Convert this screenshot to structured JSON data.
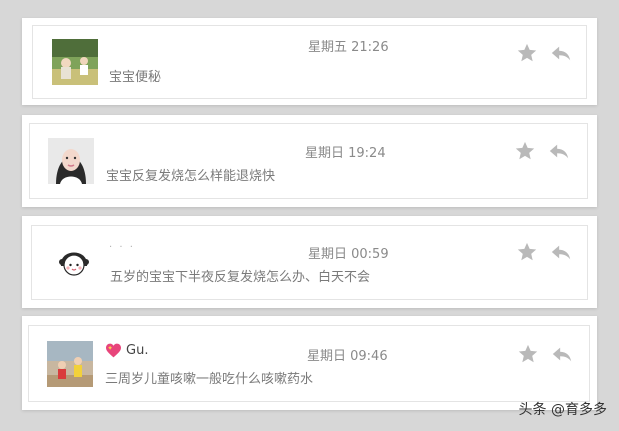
{
  "messages": [
    {
      "time": "星期五 21:26",
      "subject": "宝宝便秘",
      "avatar": "outdoor-children-photo"
    },
    {
      "time": "星期日 19:24",
      "subject": "宝宝反复发烧怎么样能退烧快",
      "avatar": "woman-portrait-photo"
    },
    {
      "time": "星期日 00:59",
      "subject": "五岁的宝宝下半夜反复发烧怎么办、白天不会",
      "sender_dots": "· · ·",
      "avatar": "cartoon-girl-drawing"
    },
    {
      "time": "星期日 09:46",
      "subject": "三周岁儿童咳嗽一般吃什么咳嗽药水",
      "sender": "Gu.",
      "avatar": "two-kids-outdoor-photo"
    }
  ],
  "icons": {
    "star": "star-icon",
    "reply": "reply-arrow-icon",
    "heart": "sparkling-heart-icon"
  },
  "watermark": "头条 @育多多",
  "colors": {
    "background": "#d7d7d7",
    "card": "#ffffff",
    "icon": "#b9b9b9",
    "time_text": "#8a8a8a",
    "subject_text": "#7a7a7a"
  }
}
